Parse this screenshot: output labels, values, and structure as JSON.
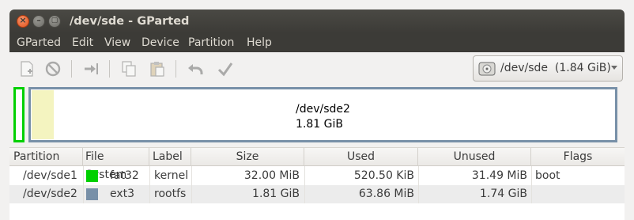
{
  "window": {
    "title": "/dev/sde - GParted"
  },
  "window_controls": {
    "close": "×",
    "minimize": "–",
    "maximize": "▢"
  },
  "menu": [
    "GParted",
    "Edit",
    "View",
    "Device",
    "Partition",
    "Help"
  ],
  "device_selector": {
    "value": "/dev/sde  (1.84 GiB)"
  },
  "disk_map": {
    "partition_name": "/dev/sde2",
    "partition_size": "1.81 GiB",
    "used_fraction": 0.034
  },
  "table": {
    "headers": [
      "Partition",
      "File System",
      "Label",
      "Size",
      "Used",
      "Unused",
      "Flags"
    ],
    "rows": [
      {
        "partition": "/dev/sde1",
        "fs": "fat32",
        "fs_color": "#00d000",
        "label": "kernel",
        "size": "32.00 MiB",
        "used": "520.50 KiB",
        "unused": "31.49 MiB",
        "flags": "boot"
      },
      {
        "partition": "/dev/sde2",
        "fs": "ext3",
        "fs_color": "#7890a8",
        "label": "rootfs",
        "size": "1.81 GiB",
        "used": "63.86 MiB",
        "unused": "1.74 GiB",
        "flags": ""
      }
    ]
  }
}
